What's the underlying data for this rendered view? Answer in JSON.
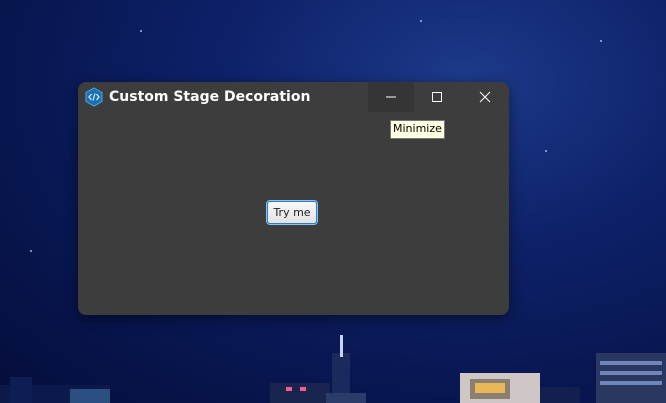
{
  "window": {
    "title": "Custom Stage Decoration",
    "app_icon": "code-icon",
    "controls": {
      "minimize": "minimize-icon",
      "maximize": "maximize-icon",
      "close": "close-icon"
    }
  },
  "tooltip": {
    "text": "Minimize"
  },
  "content": {
    "button_label": "Try me"
  },
  "colors": {
    "window_background": "#3d3d3d",
    "title_text": "#ffffff",
    "desktop_background": "#0e226a",
    "button_focus_border": "#2a7fc4",
    "tooltip_background": "#ffffe1"
  }
}
